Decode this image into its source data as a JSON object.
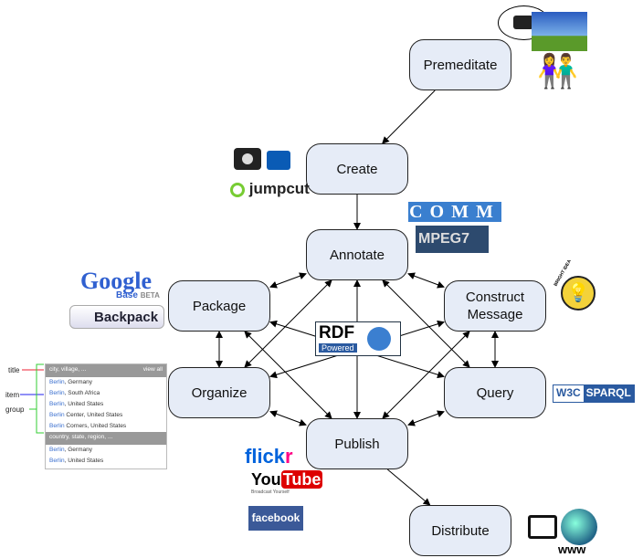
{
  "nodes": {
    "premeditate": "Premeditate",
    "create": "Create",
    "annotate": "Annotate",
    "package": "Package",
    "construct": "Construct Message",
    "organize": "Organize",
    "query": "Query",
    "publish": "Publish",
    "distribute": "Distribute"
  },
  "logos": {
    "jumpcut": "jumpcut",
    "comm": "COMM",
    "mpeg7": "MPEG7",
    "google": "Google",
    "google_base": "Base",
    "google_beta": "BETA",
    "backpack": "Backpack",
    "rdf": "RDF",
    "rdf_powered": "Powered",
    "bright_idea": "BRIGHT IDEA",
    "w3c": "W3C",
    "sparql": "SPARQL",
    "flickr": "flickr",
    "youtube_you": "You",
    "youtube_tube": "Tube",
    "youtube_tag": "Broadcast Yourself",
    "facebook": "facebook",
    "www": "www"
  },
  "list": {
    "labels": {
      "title": "title",
      "item": "item",
      "group": "group"
    },
    "groups": [
      {
        "title": "city, village, ...",
        "view_all": "view all",
        "items": [
          [
            "Berlin",
            ", Germany"
          ],
          [
            "Berlin",
            ", South Africa"
          ],
          [
            "Berlin",
            ", United States"
          ],
          [
            "Berlin",
            " Center, United States"
          ],
          [
            "Berlin",
            " Corners, United States"
          ]
        ]
      },
      {
        "title": "country, state, region, ...",
        "items": [
          [
            "Berlin",
            ", Germany"
          ],
          [
            "Berlin",
            ", United States"
          ]
        ]
      }
    ]
  }
}
